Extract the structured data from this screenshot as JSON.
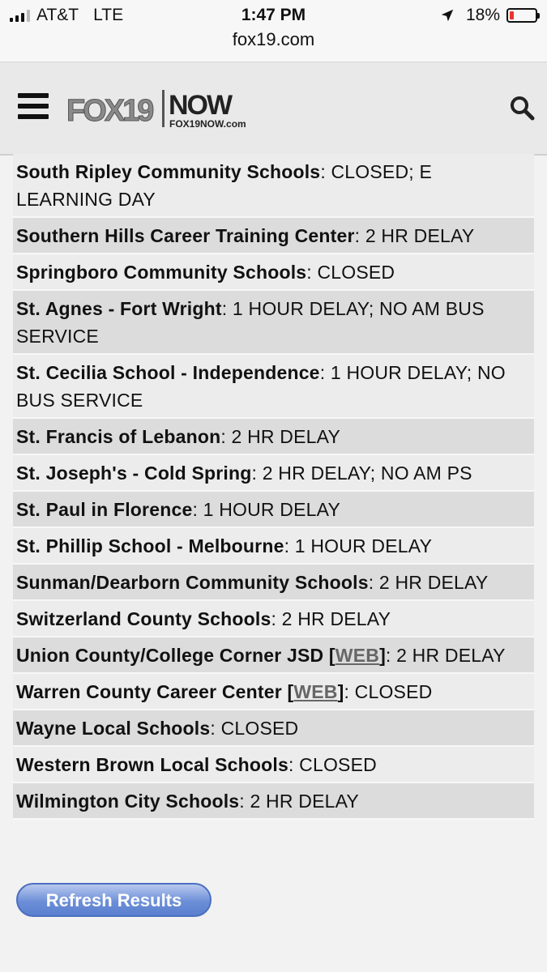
{
  "status_bar": {
    "carrier": "AT&T",
    "network": "LTE",
    "time": "1:47 PM",
    "battery": "18%",
    "battery_level": 0.18,
    "url": "fox19.com",
    "icons": [
      "signal-icon",
      "location-arrow-icon",
      "battery-icon"
    ]
  },
  "header": {
    "logo_text_fox": "FOX19",
    "logo_text_now": "NOW",
    "logo_text_domain": "FOX19NOW.com",
    "icons": [
      "menu-icon",
      "search-icon"
    ]
  },
  "closings": [
    {
      "name": "South Ripley Community Schools",
      "status": ": CLOSED; E LEARNING DAY"
    },
    {
      "name": "Southern Hills Career Training Center",
      "status": ": 2 HR DELAY"
    },
    {
      "name": "Springboro Community Schools",
      "status": ": CLOSED"
    },
    {
      "name": "St. Agnes - Fort Wright",
      "status": ": 1 HOUR DELAY; NO AM BUS SERVICE"
    },
    {
      "name": "St. Cecilia School - Independence",
      "status": ": 1 HOUR DELAY; NO BUS SERVICE"
    },
    {
      "name": "St. Francis of Lebanon",
      "status": ": 2 HR DELAY"
    },
    {
      "name": "St. Joseph's - Cold Spring",
      "status": ": 2 HR DELAY; NO AM PS"
    },
    {
      "name": "St. Paul in Florence",
      "status": ": 1 HOUR DELAY"
    },
    {
      "name": "St. Phillip School - Melbourne",
      "status": ": 1 HOUR DELAY"
    },
    {
      "name": "Sunman/Dearborn Community Schools",
      "status": ": 2 HR DELAY"
    },
    {
      "name": "Switzerland County Schools",
      "status": ": 2 HR DELAY"
    },
    {
      "name": "Union County/College Corner JSD [",
      "web": "WEB",
      "name_end": "]",
      "status": ": 2 HR DELAY"
    },
    {
      "name": "Warren County Career Center [",
      "web": "WEB",
      "name_end": "]",
      "status": ": CLOSED"
    },
    {
      "name": "Wayne Local Schools",
      "status": ": CLOSED"
    },
    {
      "name": "Western Brown Local Schools",
      "status": ": CLOSED"
    },
    {
      "name": "Wilmington City Schools",
      "status": ": 2 HR DELAY"
    }
  ],
  "refresh_button": "Refresh Results"
}
